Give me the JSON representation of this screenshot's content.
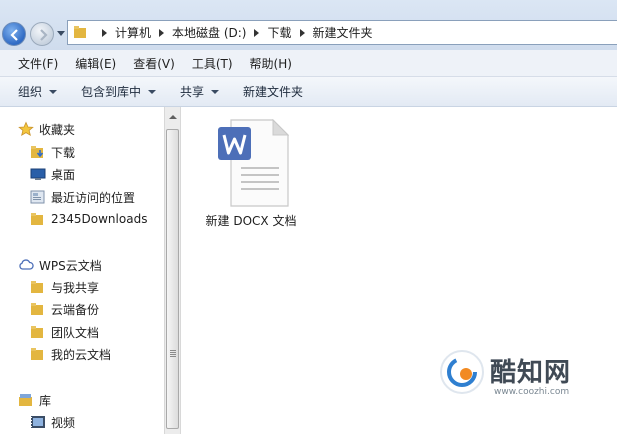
{
  "address": {
    "breadcrumbs": [
      "计算机",
      "本地磁盘 (D:)",
      "下载",
      "新建文件夹"
    ]
  },
  "menu": {
    "items": [
      "文件(F)",
      "编辑(E)",
      "查看(V)",
      "工具(T)",
      "帮助(H)"
    ]
  },
  "toolbar": {
    "organize": "组织",
    "include_library": "包含到库中",
    "share": "共享",
    "new_folder": "新建文件夹"
  },
  "sidebar": {
    "favorites_header": "收藏夹",
    "favorites": [
      "下载",
      "桌面",
      "最近访问的位置",
      "2345Downloads"
    ],
    "wps_header": "WPS云文档",
    "wps_items": [
      "与我共享",
      "云端备份",
      "团队文档",
      "我的云文档"
    ],
    "library_header": "库",
    "library_items": [
      "视频"
    ]
  },
  "files": [
    {
      "name": "新建 DOCX 文档",
      "icon": "wps-writer-doc-icon"
    }
  ],
  "watermark": {
    "title": "酷知网",
    "url": "www.coozhi.com"
  },
  "colors": {
    "wps_blue": "#4d6fb8",
    "folder_yellow": "#e8bd45",
    "toolbar_bg": "#e6edf6"
  }
}
